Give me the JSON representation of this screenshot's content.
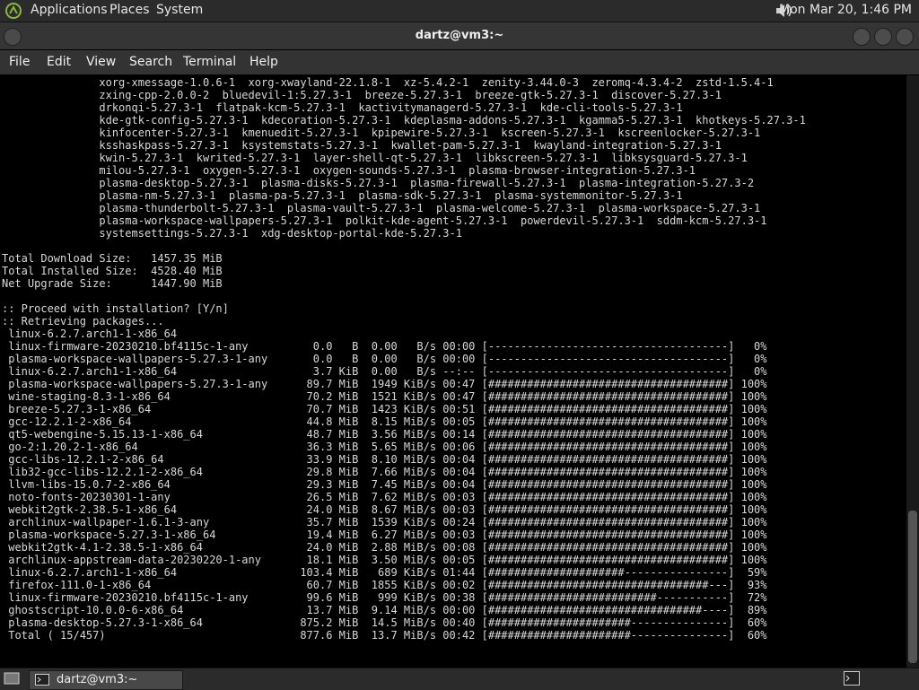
{
  "top_panel": {
    "menus": [
      "Applications",
      "Places",
      "System"
    ],
    "clock": "Mon Mar 20,  1:46 PM",
    "icons": {
      "app": "mate-logo-icon",
      "volume": "volume-icon"
    }
  },
  "window": {
    "title": "dartz@vm3:~"
  },
  "menubar": [
    "File",
    "Edit",
    "View",
    "Search",
    "Terminal",
    "Help"
  ],
  "terminal": {
    "lines": [
      "               xorg-xmessage-1.0.6-1  xorg-xwayland-22.1.8-1  xz-5.4.2-1  zenity-3.44.0-3  zeromq-4.3.4-2  zstd-1.5.4-1",
      "               zxing-cpp-2.0.0-2  bluedevil-1:5.27.3-1  breeze-5.27.3-1  breeze-gtk-5.27.3-1  discover-5.27.3-1",
      "               drkonqi-5.27.3-1  flatpak-kcm-5.27.3-1  kactivitymanagerd-5.27.3-1  kde-cli-tools-5.27.3-1",
      "               kde-gtk-config-5.27.3-1  kdecoration-5.27.3-1  kdeplasma-addons-5.27.3-1  kgamma5-5.27.3-1  khotkeys-5.27.3-1",
      "               kinfocenter-5.27.3-1  kmenuedit-5.27.3-1  kpipewire-5.27.3-1  kscreen-5.27.3-1  kscreenlocker-5.27.3-1",
      "               ksshaskpass-5.27.3-1  ksystemstats-5.27.3-1  kwallet-pam-5.27.3-1  kwayland-integration-5.27.3-1",
      "               kwin-5.27.3-1  kwrited-5.27.3-1  layer-shell-qt-5.27.3-1  libkscreen-5.27.3-1  libksysguard-5.27.3-1",
      "               milou-5.27.3-1  oxygen-5.27.3-1  oxygen-sounds-5.27.3-1  plasma-browser-integration-5.27.3-1",
      "               plasma-desktop-5.27.3-1  plasma-disks-5.27.3-1  plasma-firewall-5.27.3-1  plasma-integration-5.27.3-2",
      "               plasma-nm-5.27.3-1  plasma-pa-5.27.3-1  plasma-sdk-5.27.3-1  plasma-systemmonitor-5.27.3-1",
      "               plasma-thunderbolt-5.27.3-1  plasma-vault-5.27.3-1  plasma-welcome-5.27.3-1  plasma-workspace-5.27.3-1",
      "               plasma-workspace-wallpapers-5.27.3-1  polkit-kde-agent-5.27.3-1  powerdevil-5.27.3-1  sddm-kcm-5.27.3-1",
      "               systemsettings-5.27.3-1  xdg-desktop-portal-kde-5.27.3-1",
      "",
      "Total Download Size:   1457.35 MiB",
      "Total Installed Size:  4528.40 MiB",
      "Net Upgrade Size:      1447.90 MiB",
      "",
      ":: Proceed with installation? [Y/n]",
      ":: Retrieving packages...",
      " linux-6.2.7.arch1-1-x86_64",
      " linux-firmware-20230210.bf4115c-1-any          0.0   B  0.00   B/s 00:00 [-------------------------------------]   0%",
      " plasma-workspace-wallpapers-5.27.3-1-any       0.0   B  0.00   B/s 00:00 [-------------------------------------]   0%",
      " linux-6.2.7.arch1-1-x86_64                     3.7 KiB  0.00   B/s --:-- [-------------------------------------]   0%",
      " plasma-workspace-wallpapers-5.27.3-1-any      89.7 MiB  1949 KiB/s 00:47 [#####################################] 100%",
      " wine-staging-8.3-1-x86_64                     70.2 MiB  1521 KiB/s 00:47 [#####################################] 100%",
      " breeze-5.27.3-1-x86_64                        70.7 MiB  1423 KiB/s 00:51 [#####################################] 100%",
      " gcc-12.2.1-2-x86_64                           44.8 MiB  8.15 MiB/s 00:05 [#####################################] 100%",
      " qt5-webengine-5.15.13-1-x86_64                48.7 MiB  3.56 MiB/s 00:14 [#####################################] 100%",
      " go-2:1.20.2-1-x86_64                          36.3 MiB  5.65 MiB/s 00:06 [#####################################] 100%",
      " gcc-libs-12.2.1-2-x86_64                      33.9 MiB  8.10 MiB/s 00:04 [#####################################] 100%",
      " lib32-gcc-libs-12.2.1-2-x86_64                29.8 MiB  7.66 MiB/s 00:04 [#####################################] 100%",
      " llvm-libs-15.0.7-2-x86_64                     29.3 MiB  7.45 MiB/s 00:04 [#####################################] 100%",
      " noto-fonts-20230301-1-any                     26.5 MiB  7.62 MiB/s 00:03 [#####################################] 100%",
      " webkit2gtk-2.38.5-1-x86_64                    24.0 MiB  8.67 MiB/s 00:03 [#####################################] 100%",
      " archlinux-wallpaper-1.6.1-3-any               35.7 MiB  1539 KiB/s 00:24 [#####################################] 100%",
      " plasma-workspace-5.27.3-1-x86_64              19.4 MiB  6.27 MiB/s 00:03 [#####################################] 100%",
      " webkit2gtk-4.1-2.38.5-1-x86_64                24.0 MiB  2.88 MiB/s 00:08 [#####################################] 100%",
      " archlinux-appstream-data-20230220-1-any       18.1 MiB  3.50 MiB/s 00:05 [#####################################] 100%",
      " linux-6.2.7.arch1-1-x86_64                   103.4 MiB   689 KiB/s 01:44 [#####################----------------]  59%",
      " firefox-111.0-1-x86_64                        60.7 MiB  1855 KiB/s 00:02 [##################################---]  93%",
      " linux-firmware-20230210.bf4115c-1-any         99.6 MiB   999 KiB/s 00:38 [##########################-----------]  72%",
      " ghostscript-10.0.0-6-x86_64                   13.7 MiB  9.14 MiB/s 00:00 [#################################----]  89%",
      " plasma-desktop-5.27.3-1-x86_64               875.2 MiB  14.5 MiB/s 00:40 [######################---------------]  60%",
      " Total ( 15/457)                              877.6 MiB  13.7 MiB/s 00:42 [######################---------------]  60%"
    ]
  },
  "taskbar": {
    "item_label": "dartz@vm3:~",
    "icons": {
      "desktop": "show-desktop-icon",
      "terminal": "terminal-icon"
    }
  }
}
